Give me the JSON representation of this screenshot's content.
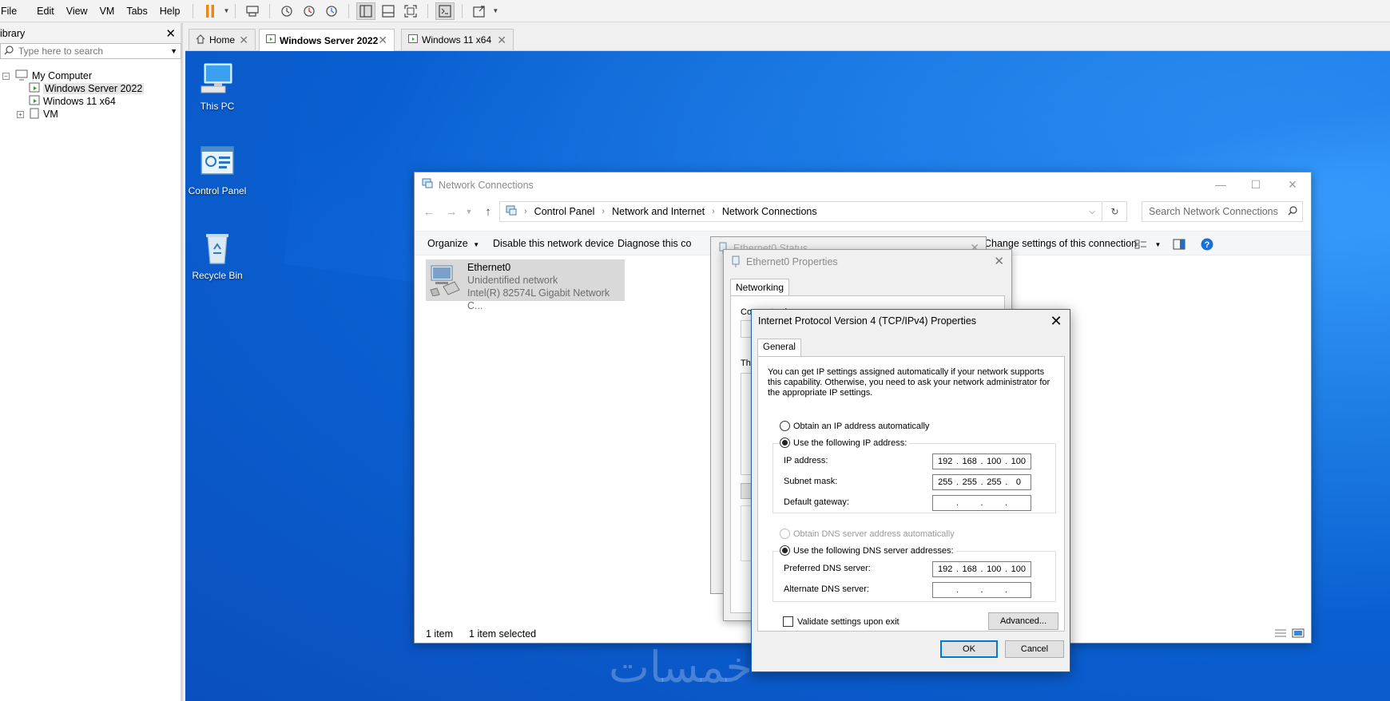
{
  "menubar": {
    "items": [
      "File",
      "Edit",
      "View",
      "VM",
      "Tabs",
      "Help"
    ]
  },
  "library": {
    "title": "ibrary",
    "search_placeholder": "Type here to search",
    "tree": [
      {
        "label": "My Computer"
      },
      {
        "label": "Windows Server 2022"
      },
      {
        "label": "Windows 11 x64"
      },
      {
        "label": "VM"
      }
    ]
  },
  "tabs": [
    {
      "label": "Home"
    },
    {
      "label": "Windows Server 2022"
    },
    {
      "label": "Windows 11 x64"
    }
  ],
  "desktop": {
    "icons": [
      {
        "label": "This PC",
        "icon": "this-pc-icon"
      },
      {
        "label": "Control Panel",
        "icon": "control-panel-icon"
      },
      {
        "label": "Recycle Bin",
        "icon": "recycle-bin-icon"
      }
    ],
    "watermark": "خمسات"
  },
  "network_connections": {
    "title": "Network Connections",
    "breadcrumb": [
      "Control Panel",
      "Network and Internet",
      "Network Connections"
    ],
    "search_placeholder": "Search Network Connections",
    "commands": {
      "organize": "Organize",
      "disable": "Disable this network device",
      "diagnose": "Diagnose this co",
      "rename_tail": "ection",
      "change_settings": "Change settings of this connection"
    },
    "adapter": {
      "name": "Ethernet0",
      "status": "Unidentified network",
      "device": "Intel(R) 82574L Gigabit Network C..."
    },
    "status": {
      "items": "1 item",
      "selected": "1 item selected"
    }
  },
  "ethernet_status": {
    "title": "Ethernet0 Status"
  },
  "ethernet_properties": {
    "title": "Ethernet0 Properties",
    "tab": "Networking",
    "connect_using_label": "Connect using:",
    "this_connection_prefix": "Th"
  },
  "ipv4": {
    "title": "Internet Protocol Version 4 (TCP/IPv4) Properties",
    "tab": "General",
    "description": "You can get IP settings assigned automatically if your network supports this capability. Otherwise, you need to ask your network administrator for the appropriate IP settings.",
    "obtain_ip_auto": "Obtain an IP address automatically",
    "use_following_ip": "Use the following IP address:",
    "ip_address_label": "IP address:",
    "ip_address": [
      "192",
      "168",
      "100",
      "100"
    ],
    "subnet_label": "Subnet mask:",
    "subnet": [
      "255",
      "255",
      "255",
      "0"
    ],
    "gateway_label": "Default gateway:",
    "gateway": [
      "",
      "",
      "",
      ""
    ],
    "obtain_dns_auto": "Obtain DNS server address automatically",
    "use_following_dns": "Use the following DNS server addresses:",
    "preferred_dns_label": "Preferred DNS server:",
    "preferred_dns": [
      "192",
      "168",
      "100",
      "100"
    ],
    "alternate_dns_label": "Alternate DNS server:",
    "alternate_dns": [
      "",
      "",
      "",
      ""
    ],
    "validate_label": "Validate settings upon exit",
    "advanced_label": "Advanced...",
    "ok_label": "OK",
    "cancel_label": "Cancel",
    "selected_ip_mode": "manual",
    "selected_dns_mode": "manual",
    "validate_checked": false
  },
  "colors": {
    "desktop": "#0a5fd0",
    "accent": "#0078d7",
    "pause_icon": "#e8891a"
  }
}
